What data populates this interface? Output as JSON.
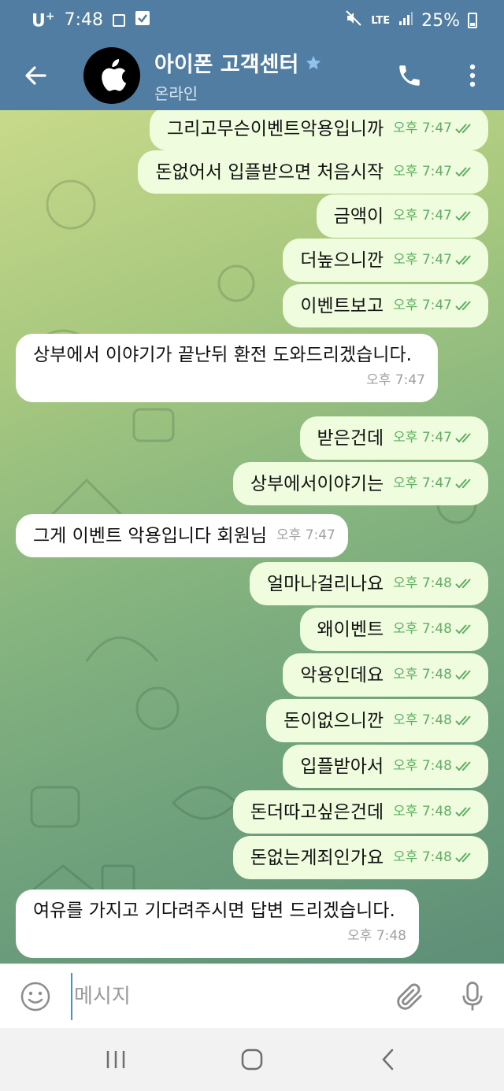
{
  "status_bar": {
    "carrier": "U",
    "carrier_sup": "+",
    "time": "7:48",
    "network": "LTE",
    "battery": "25%"
  },
  "header": {
    "title": "아이폰 고객센터",
    "status": "온라인",
    "verified_icon": "star-icon",
    "accent_color": "#517da2"
  },
  "messages": [
    {
      "dir": "out",
      "text": "그리고무슨이벤트악용입니까",
      "time": "오후 7:47"
    },
    {
      "dir": "out",
      "text": "돈없어서 입플받으면 처음시작",
      "time": "오후 7:47"
    },
    {
      "dir": "out",
      "text": "금액이",
      "time": "오후 7:47"
    },
    {
      "dir": "out",
      "text": "더높으니깐",
      "time": "오후 7:47"
    },
    {
      "dir": "out",
      "text": "이벤트보고",
      "time": "오후 7:47"
    },
    {
      "dir": "in",
      "text": "상부에서 이야기가 끝난뒤 환전 도와드리겠습니다.",
      "time": "오후 7:47"
    },
    {
      "dir": "out",
      "text": "받은건데",
      "time": "오후 7:47"
    },
    {
      "dir": "out",
      "text": "상부에서이야기는",
      "time": "오후 7:47"
    },
    {
      "dir": "in",
      "text": "그게 이벤트 악용입니다 회원님",
      "time": "오후 7:47"
    },
    {
      "dir": "out",
      "text": "얼마나걸리나요",
      "time": "오후 7:48"
    },
    {
      "dir": "out",
      "text": "왜이벤트",
      "time": "오후 7:48"
    },
    {
      "dir": "out",
      "text": "악용인데요",
      "time": "오후 7:48"
    },
    {
      "dir": "out",
      "text": "돈이없으니깐",
      "time": "오후 7:48"
    },
    {
      "dir": "out",
      "text": "입플받아서",
      "time": "오후 7:48"
    },
    {
      "dir": "out",
      "text": "돈더따고싶은건데",
      "time": "오후 7:48"
    },
    {
      "dir": "out",
      "text": "돈없는게죄인가요",
      "time": "오후 7:48"
    },
    {
      "dir": "in",
      "text": "여유를 가지고 기다려주시면 답변 드리겠습니다.",
      "time": "오후 7:48"
    }
  ],
  "composer": {
    "placeholder": "메시지"
  },
  "colors": {
    "outgoing_bubble": "#effdde",
    "incoming_bubble": "#ffffff",
    "read_check": "#5fae63"
  }
}
